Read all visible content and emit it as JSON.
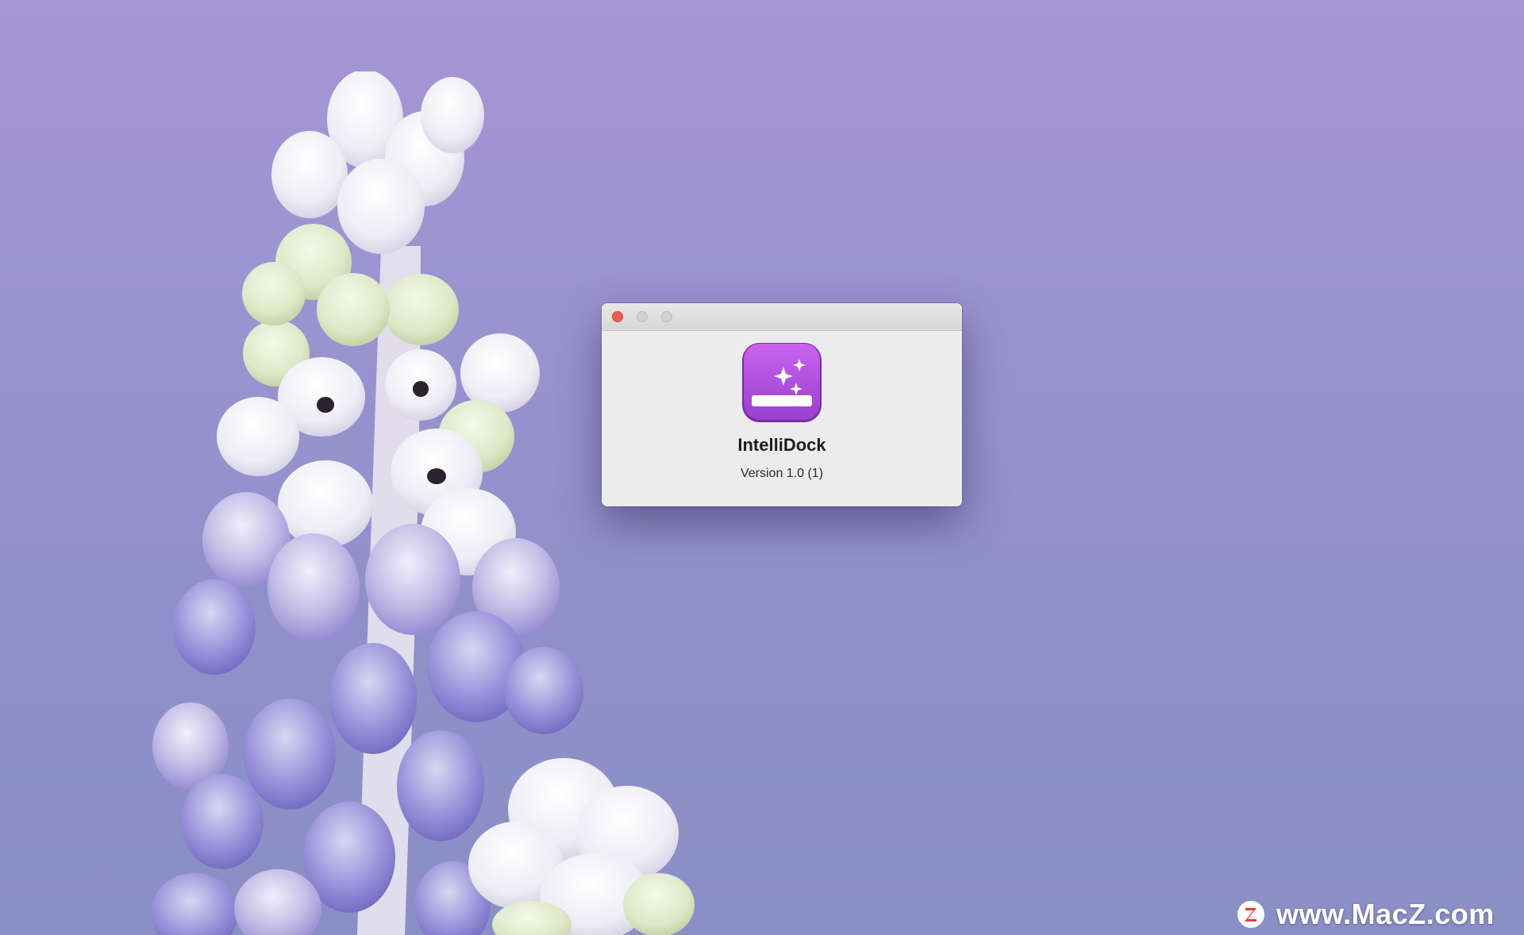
{
  "window": {
    "app_name": "IntelliDock",
    "version": "Version 1.0 (1)",
    "buttons": {
      "close": "close-button",
      "minimize": "minimize-button",
      "zoom": "zoom-button"
    },
    "icon": "intellidock-app-icon"
  },
  "watermark": {
    "text": "www.MacZ.com"
  },
  "colors": {
    "wallpaper_top": "#a596d4",
    "wallpaper_bottom": "#8a8fc6",
    "app_icon_purple": "#b54fe0",
    "close_red": "#ee5e57",
    "watermark_red": "#e63b2e"
  },
  "icons": {
    "app": "sparkles-dock-icon",
    "watermark": "macz-logo-icon",
    "wallpaper": "hyacinth-flower-wallpaper"
  }
}
